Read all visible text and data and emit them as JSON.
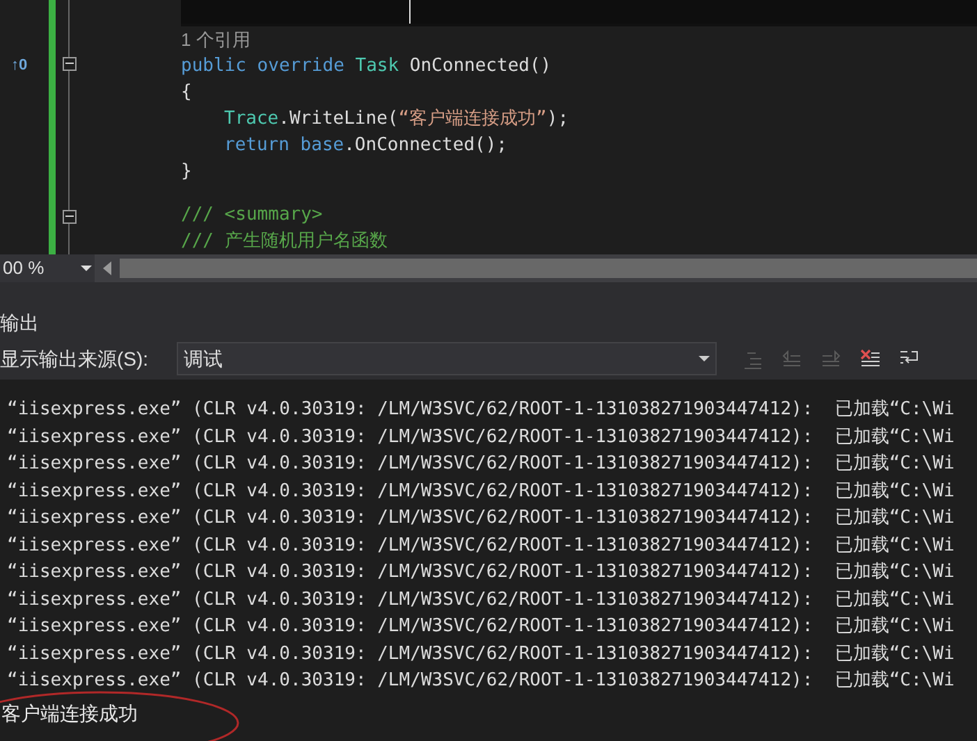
{
  "editor": {
    "lines": [
      {
        "current": true,
        "collapsible": false
      },
      {
        "current": false,
        "collapsible": false,
        "tokens": [
          {
            "text": "1 个引用",
            "kind": "codelens"
          }
        ]
      },
      {
        "current": false,
        "collapsible": true,
        "gutter": "↑0",
        "tokens": [
          {
            "text": "public ",
            "kind": "keyword"
          },
          {
            "text": "override ",
            "kind": "keyword"
          },
          {
            "text": "Task",
            "kind": "type"
          },
          {
            "text": " OnConnected()",
            "kind": "plain"
          }
        ]
      },
      {
        "current": false,
        "collapsible": false,
        "tokens": [
          {
            "text": "{",
            "kind": "plain"
          }
        ]
      },
      {
        "current": false,
        "collapsible": false,
        "indented": true,
        "tokens": [
          {
            "text": "Trace",
            "kind": "type"
          },
          {
            "text": ".WriteLine(",
            "kind": "plain"
          },
          {
            "text": "“客户端连接成功”",
            "kind": "string"
          },
          {
            "text": ");",
            "kind": "plain"
          }
        ]
      },
      {
        "current": false,
        "collapsible": false,
        "indented": true,
        "tokens": [
          {
            "text": "return ",
            "kind": "keyword"
          },
          {
            "text": "base",
            "kind": "keyword"
          },
          {
            "text": ".OnConnected();",
            "kind": "plain"
          }
        ]
      },
      {
        "current": false,
        "collapsible": false,
        "tokens": [
          {
            "text": "}",
            "kind": "plain"
          }
        ]
      },
      {
        "current": false,
        "collapsible": false
      },
      {
        "current": false,
        "collapsible": true,
        "tokens": [
          {
            "text": "/// <summary>",
            "kind": "comment"
          }
        ]
      },
      {
        "current": false,
        "collapsible": false,
        "tokens": [
          {
            "text": "/// 产生随机用户名函数",
            "kind": "comment"
          }
        ]
      }
    ],
    "zoom": "00 %"
  },
  "output": {
    "title": "输出",
    "source_label": "显示输出来源(S):",
    "source_value": "调试",
    "tools": [
      {
        "kind": "goto",
        "disabled": true
      },
      {
        "kind": "prev",
        "disabled": true
      },
      {
        "kind": "next",
        "disabled": true
      },
      {
        "kind": "clear",
        "disabled": false
      },
      {
        "kind": "wrap",
        "disabled": false
      }
    ],
    "lines": [
      "“iisexpress.exe” (CLR v4.0.30319: /LM/W3SVC/62/ROOT-1-131038271903447412):  已加载“C:\\Wi",
      "“iisexpress.exe” (CLR v4.0.30319: /LM/W3SVC/62/ROOT-1-131038271903447412):  已加载“C:\\Wi",
      "“iisexpress.exe” (CLR v4.0.30319: /LM/W3SVC/62/ROOT-1-131038271903447412):  已加载“C:\\Wi",
      "“iisexpress.exe” (CLR v4.0.30319: /LM/W3SVC/62/ROOT-1-131038271903447412):  已加载“C:\\Wi",
      "“iisexpress.exe” (CLR v4.0.30319: /LM/W3SVC/62/ROOT-1-131038271903447412):  已加载“C:\\Wi",
      "“iisexpress.exe” (CLR v4.0.30319: /LM/W3SVC/62/ROOT-1-131038271903447412):  已加载“C:\\Wi",
      "“iisexpress.exe” (CLR v4.0.30319: /LM/W3SVC/62/ROOT-1-131038271903447412):  已加载“C:\\Wi",
      "“iisexpress.exe” (CLR v4.0.30319: /LM/W3SVC/62/ROOT-1-131038271903447412):  已加载“C:\\Wi",
      "“iisexpress.exe” (CLR v4.0.30319: /LM/W3SVC/62/ROOT-1-131038271903447412):  已加载“C:\\Wi",
      "“iisexpress.exe” (CLR v4.0.30319: /LM/W3SVC/62/ROOT-1-131038271903447412):  已加载“C:\\Wi",
      "“iisexpress.exe” (CLR v4.0.30319: /LM/W3SVC/62/ROOT-1-131038271903447412):  已加载“C:\\Wi"
    ],
    "message": {
      "text": "客户端连接成功",
      "circled": true
    }
  }
}
